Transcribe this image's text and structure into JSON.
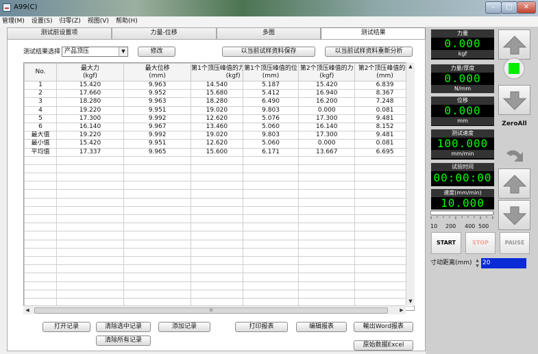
{
  "window": {
    "title": "A99(C)"
  },
  "menu": [
    "管理(M)",
    "设置(S)",
    "归零(Z)",
    "视图(V)",
    "帮助(H)"
  ],
  "tabs": [
    "测试前设置项",
    "力量-位移",
    "多图",
    "测试结果"
  ],
  "toolbar": {
    "select_label": "测试结果选择",
    "select_value": "产品顶压",
    "modify": "修改",
    "save_cond": "以当前试样资料保存",
    "reanalyze": "以当前试样资料重新分析"
  },
  "table": {
    "headers": [
      [
        "No.",
        ""
      ],
      [
        "最大力",
        "(kgf)"
      ],
      [
        "最大位移",
        "(mm)"
      ],
      [
        "第1个顶压峰值的力",
        "(kgf)"
      ],
      [
        "第1个顶压峰值的位",
        "(mm)"
      ],
      [
        "第2个顶压峰值的力",
        "(kgf)"
      ],
      [
        "第2个顶压峰值的位",
        "(mm)"
      ]
    ],
    "rows": [
      [
        "1",
        "15.420",
        "9.963",
        "14.540",
        "5.187",
        "15.420",
        "6.839"
      ],
      [
        "2",
        "17.660",
        "9.952",
        "15.680",
        "5.412",
        "16.940",
        "8.367"
      ],
      [
        "3",
        "18.280",
        "9.963",
        "18.280",
        "6.490",
        "16.200",
        "7.248"
      ],
      [
        "4",
        "19.220",
        "9.951",
        "19.020",
        "9.803",
        "0.000",
        "0.081"
      ],
      [
        "5",
        "17.300",
        "9.992",
        "12.620",
        "5.076",
        "17.300",
        "9.481"
      ],
      [
        "6",
        "16.140",
        "9.967",
        "13.460",
        "5.060",
        "16.140",
        "8.152"
      ],
      [
        "最大值",
        "19.220",
        "9.992",
        "19.020",
        "9.803",
        "17.300",
        "9.481"
      ],
      [
        "最小值",
        "15.420",
        "9.951",
        "12.620",
        "5.060",
        "0.000",
        "0.081"
      ],
      [
        "平均值",
        "17.337",
        "9.965",
        "15.600",
        "6.171",
        "13.667",
        "6.695"
      ]
    ],
    "scroll_thumb": "III"
  },
  "bottom_buttons": {
    "open": "打开记录",
    "clear_sel": "清除选中记录",
    "add": "添加记录",
    "print": "打印报表",
    "edit": "编辑报表",
    "word": "輸出Word报表",
    "clear_all": "清除所有记录",
    "excel": "原始数据Excel"
  },
  "displays": [
    {
      "cap": "力量",
      "val": "0.000",
      "unit": "kgf"
    },
    {
      "cap": "力量/厚度",
      "val": "0.000",
      "unit": "N/mm"
    },
    {
      "cap": "位移",
      "val": "0.000",
      "unit": "mm"
    },
    {
      "cap": "测试速度",
      "val": "100.000",
      "unit": "mm/min"
    },
    {
      "cap": "试验时间",
      "val": "00:00:00",
      "unit": ""
    },
    {
      "cap": "速度(mm/min)",
      "val": "10.000",
      "unit": ""
    }
  ],
  "speed_scale": [
    "10",
    "200",
    "400",
    "500"
  ],
  "controls": {
    "zero": "ZeroAll",
    "start": "START",
    "stop": "STOP",
    "pause": "PAUSE"
  },
  "jog": {
    "label": "寸动距离(mm)",
    "value": "20"
  },
  "colors": {
    "display_digits": "#00ff00",
    "indicator": "#00ee00",
    "stop": "#f4a49a",
    "pause": "#9a9a9a",
    "jog_field": "#0a2bd6"
  }
}
